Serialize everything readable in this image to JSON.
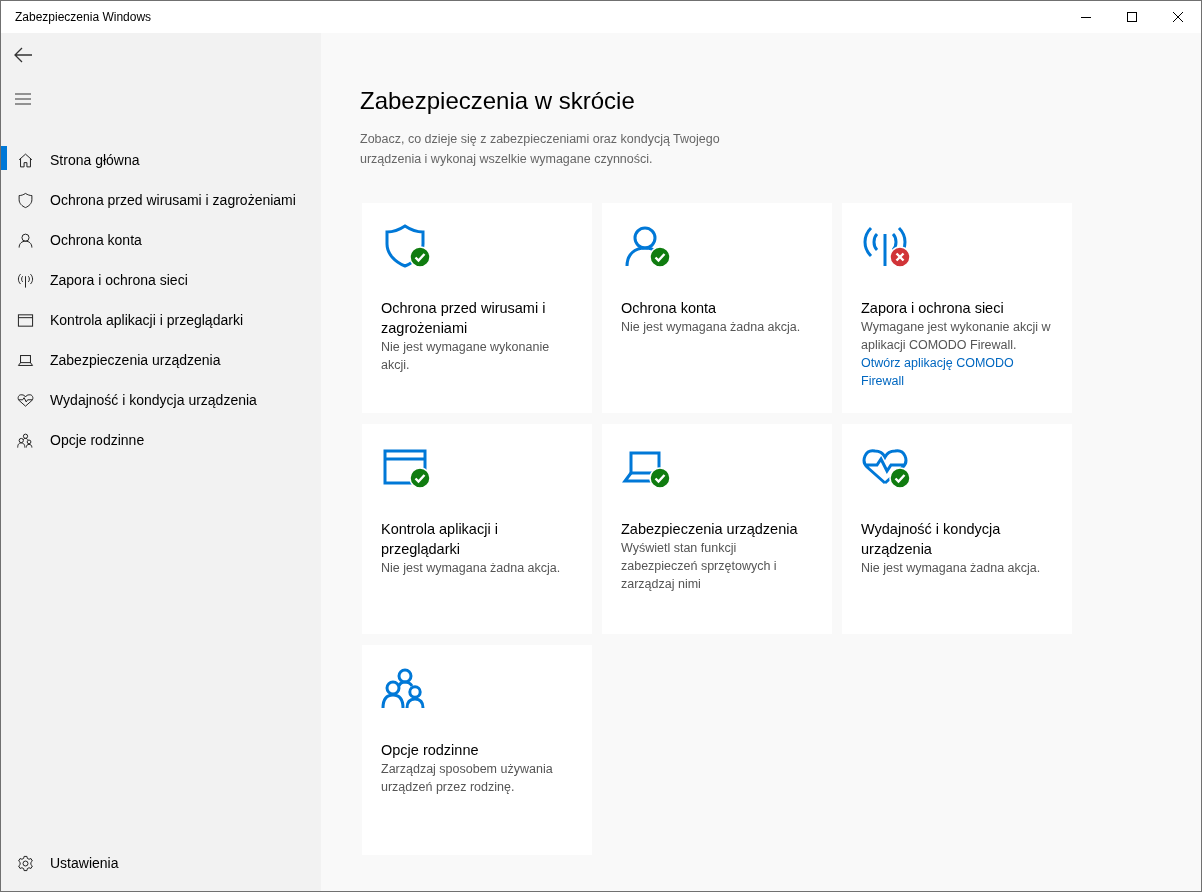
{
  "window": {
    "title": "Zabezpieczenia Windows"
  },
  "sidebar": {
    "items": [
      {
        "label": "Strona główna",
        "selected": true
      },
      {
        "label": "Ochrona przed wirusami i zagrożeniami",
        "selected": false
      },
      {
        "label": "Ochrona konta",
        "selected": false
      },
      {
        "label": "Zapora i ochrona sieci",
        "selected": false
      },
      {
        "label": "Kontrola aplikacji i przeglądarki",
        "selected": false
      },
      {
        "label": "Zabezpieczenia urządzenia",
        "selected": false
      },
      {
        "label": "Wydajność i kondycja urządzenia",
        "selected": false
      },
      {
        "label": "Opcje rodzinne",
        "selected": false
      }
    ],
    "settings": "Ustawienia"
  },
  "main": {
    "title": "Zabezpieczenia w skrócie",
    "description": "Zobacz, co dzieje się z zabezpieczeniami oraz kondycją Twojego urządzenia i wykonaj wszelkie wymagane czynności.",
    "cards": [
      {
        "kind": "ok",
        "title": "Ochrona przed wirusami i zagrożeniami",
        "description": "Nie jest wymagane wykonanie akcji."
      },
      {
        "kind": "ok",
        "title": "Ochrona konta",
        "description": "Nie jest wymagana żadna akcja."
      },
      {
        "kind": "alert",
        "title": "Zapora i ochrona sieci",
        "description": "Wymagane jest wykonanie akcji w aplikacji COMODO Firewall.",
        "link": "Otwórz aplikację COMODO Firewall"
      },
      {
        "kind": "ok",
        "title": "Kontrola aplikacji i przeglądarki",
        "description": "Nie jest wymagana żadna akcja."
      },
      {
        "kind": "ok",
        "title": "Zabezpieczenia urządzenia",
        "description": "Wyświetl stan funkcji zabezpieczeń sprzętowych i zarządzaj nimi"
      },
      {
        "kind": "ok",
        "title": "Wydajność i kondycja urządzenia",
        "description": "Nie jest wymagana żadna akcja."
      },
      {
        "kind": "plain",
        "title": "Opcje rodzinne",
        "description": "Zarządzaj sposobem używania urządzeń przez rodzinę."
      }
    ]
  }
}
